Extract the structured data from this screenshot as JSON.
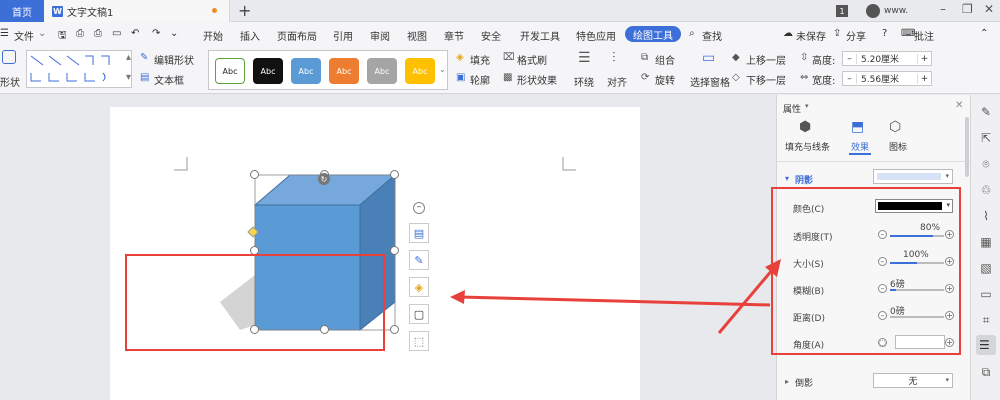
{
  "titlebar": {
    "home_tab": "首页",
    "doc_tab": "文字文稿1",
    "add_tab": "+",
    "badge": "1",
    "user": "www.",
    "min": "–",
    "restore": "❐",
    "close": "✕"
  },
  "menu": {
    "file": "文件",
    "items": [
      "开始",
      "插入",
      "页面布局",
      "引用",
      "审阅",
      "视图",
      "章节",
      "安全",
      "开发工具",
      "特色应用",
      "绘图工具"
    ],
    "search": "查找",
    "unsaved": "未保存",
    "share": "分享",
    "comment": "批注"
  },
  "ribbon": {
    "shape_label": "形状",
    "edit_shape": "编辑形状",
    "text_box": "文本框",
    "style_abc": "Abc",
    "fill": "填充",
    "format_brush": "格式刷",
    "outline": "轮廓",
    "shape_effect": "形状效果",
    "wrap": "环绕",
    "align": "对齐",
    "combine": "组合",
    "rotate": "旋转",
    "selection_pane": "选择窗格",
    "bring_forward": "上移一层",
    "send_backward": "下移一层",
    "height_label": "高度:",
    "height_value": "5.20厘米",
    "width_label": "宽度:",
    "width_value": "5.56厘米"
  },
  "colors": {
    "accent": "#3d6fd8",
    "cube_front": "#5b9bd5",
    "cube_top": "#76a8dc",
    "cube_side": "#4a80b8",
    "annotation_red": "#e8413c"
  },
  "panel": {
    "title": "属性",
    "tabs": [
      "填充与线条",
      "效果",
      "图标"
    ],
    "active_tab": "效果",
    "shadow_section": "阴影",
    "color_label": "颜色(C)",
    "transparency_label": "透明度(T)",
    "transparency_value": "80%",
    "size_label": "大小(S)",
    "size_value": "100%",
    "blur_label": "模糊(B)",
    "blur_value": "6磅",
    "distance_label": "距离(D)",
    "distance_value": "0磅",
    "angle_label": "角度(A)",
    "reflection_section": "倒影",
    "reflection_value": "无"
  }
}
